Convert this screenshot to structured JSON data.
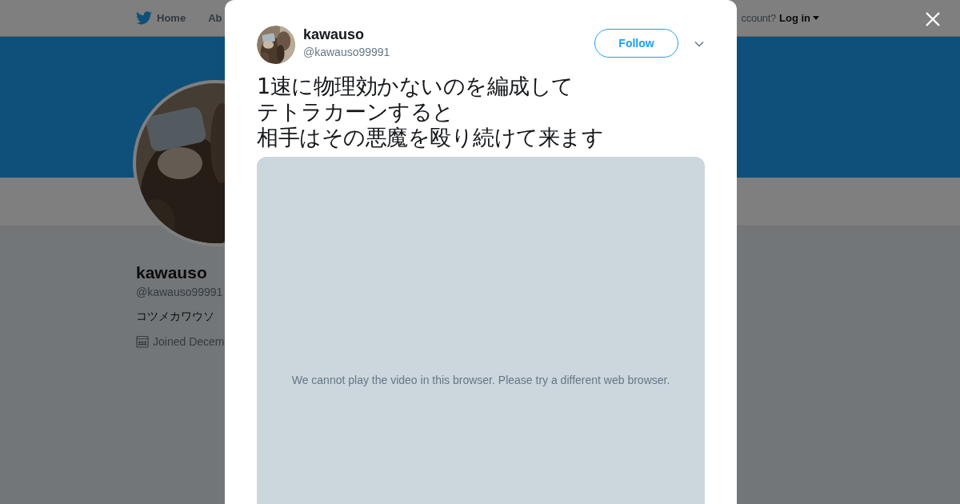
{
  "header": {
    "nav": [
      {
        "label": "Home"
      },
      {
        "label": "Ab"
      }
    ],
    "account_prompt": "ccount?",
    "login": "Log in"
  },
  "profile": {
    "name": "kawauso",
    "handle": "@kawauso99991",
    "bio": "コツメカワウソ",
    "joined": "Joined Decem"
  },
  "modal": {
    "name": "kawauso",
    "handle": "@kawauso99991",
    "follow": "Follow",
    "tweet": [
      "1速に物理効かないのを編成して",
      "テトラカーンすると",
      "相手はその悪魔を殴り続けて来ます"
    ],
    "video_message": "We cannot play the video in this browser. Please try a different web browser."
  }
}
